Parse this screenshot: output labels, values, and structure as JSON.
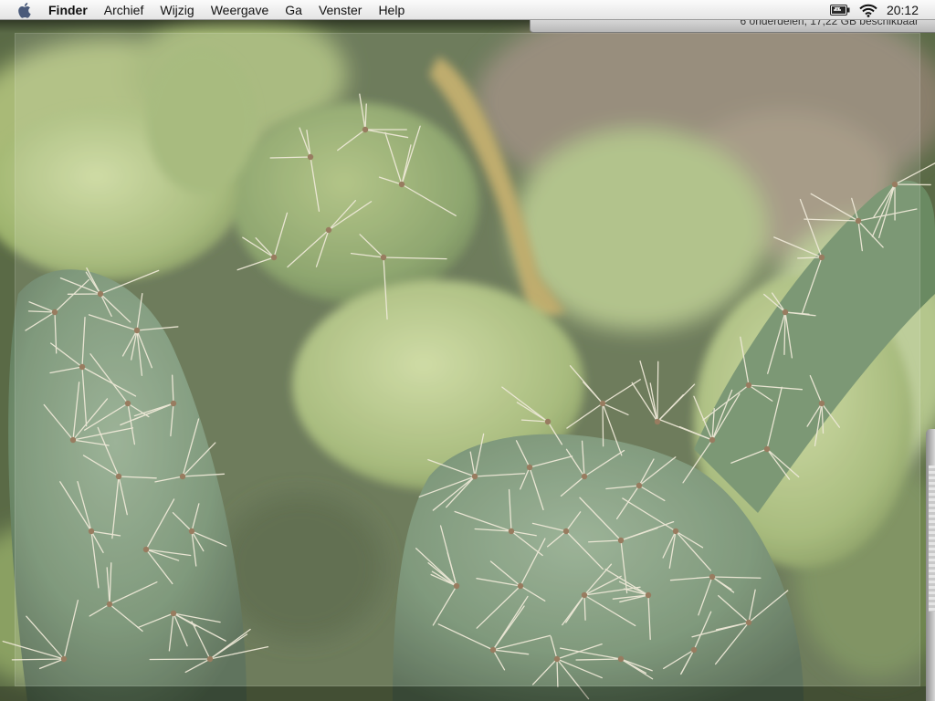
{
  "menubar": {
    "apple_icon": "apple-logo-icon",
    "app_name": "Finder",
    "items": [
      {
        "label": "Archief"
      },
      {
        "label": "Wijzig"
      },
      {
        "label": "Weergave"
      },
      {
        "label": "Ga"
      },
      {
        "label": "Venster"
      },
      {
        "label": "Help"
      }
    ],
    "status": {
      "battery_icon": "battery-charging-icon",
      "wifi_icon": "wifi-icon",
      "clock": "20:12"
    }
  },
  "desktop": {
    "background": "cactus-photo",
    "finder_status_text": "6 onderdelen, 17,22 GB beschikbaar"
  },
  "colors": {
    "menubar_top": "#fbfbfb",
    "menubar_bottom": "#e4e4e4",
    "cactus_green": "#6e8a68",
    "spine_color": "#efe9d6"
  }
}
